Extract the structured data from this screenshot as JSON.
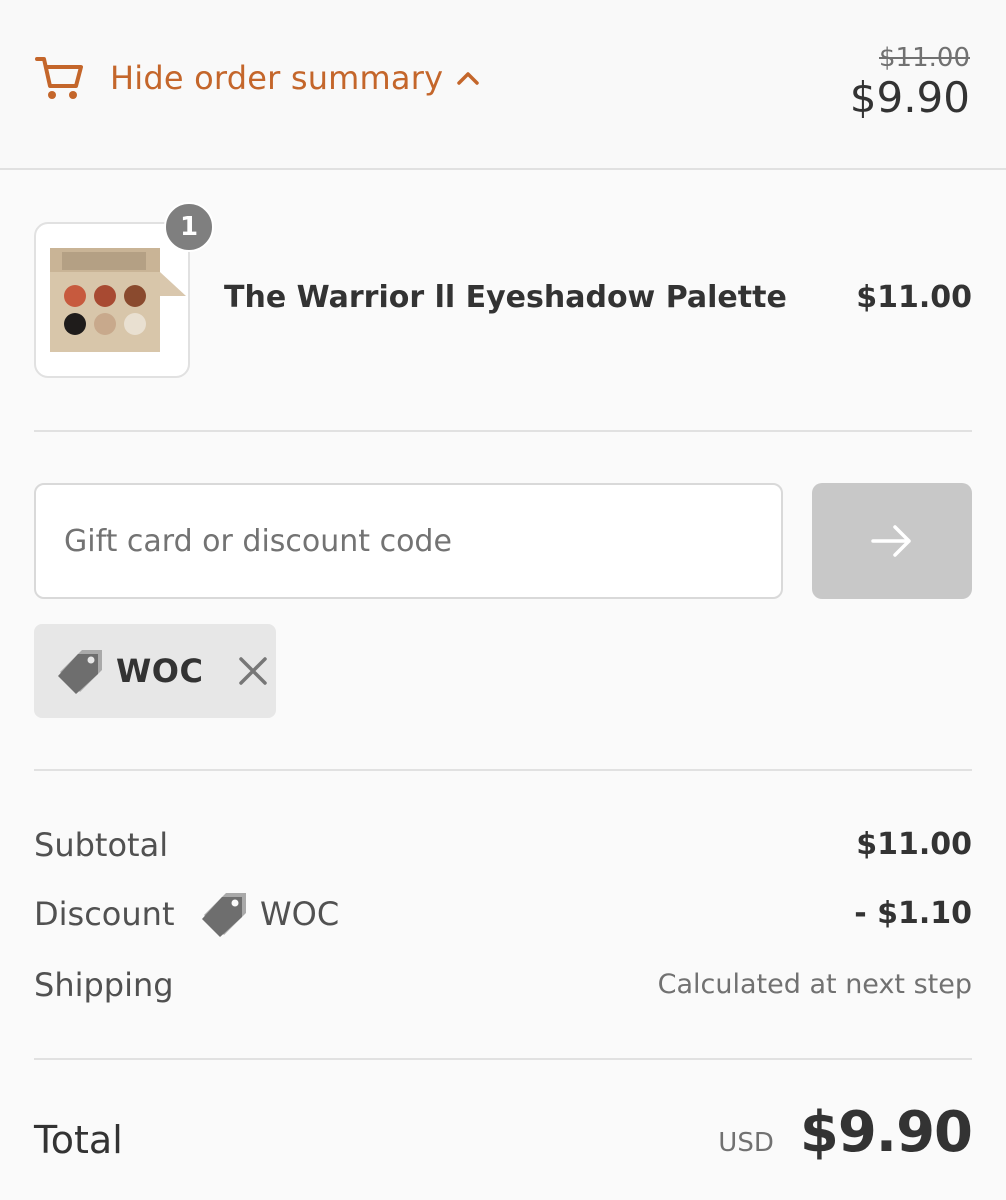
{
  "colors": {
    "accent": "#c4662b",
    "text": "#333333",
    "muted": "#717171",
    "button_disabled": "#c8c8c8"
  },
  "header": {
    "cart_icon": "cart-icon",
    "toggle_label": "Hide order summary",
    "chevron_icon": "chevron-up-icon",
    "original_price": "$11.00",
    "current_price": "$9.90"
  },
  "line_items": [
    {
      "name": "The Warrior ll Eyeshadow Palette",
      "price": "$11.00",
      "quantity": "1"
    }
  ],
  "discount_form": {
    "placeholder": "Gift card or discount code",
    "value": "",
    "apply_icon": "arrow-right-icon"
  },
  "applied_code": {
    "code": "WOC",
    "tag_icon": "tag-icon",
    "remove_icon": "close-icon"
  },
  "summary": {
    "subtotal_label": "Subtotal",
    "subtotal_value": "$11.00",
    "discount_label": "Discount",
    "discount_code": "WOC",
    "discount_value": "- $1.10",
    "shipping_label": "Shipping",
    "shipping_value": "Calculated at next step"
  },
  "total": {
    "label": "Total",
    "currency": "USD",
    "amount": "$9.90"
  }
}
